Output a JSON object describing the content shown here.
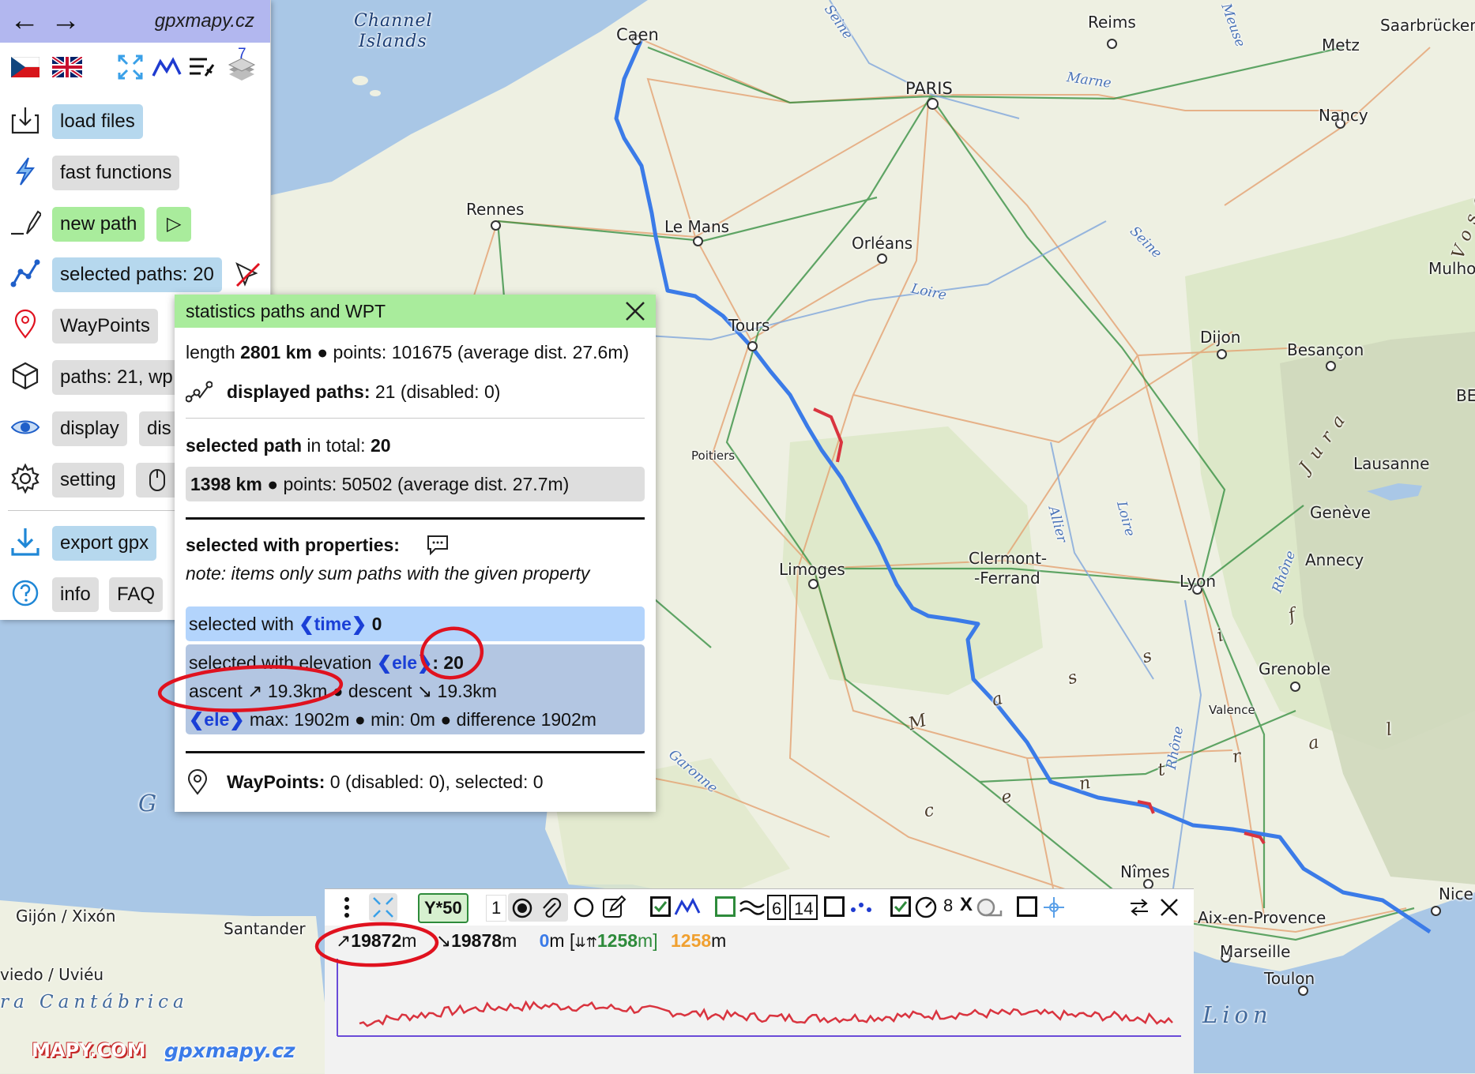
{
  "sidebar": {
    "title": "gpxmapy.cz",
    "back_glyph": "←",
    "forward_glyph": "→",
    "layers_badge": "7",
    "items": [
      {
        "label": "load files",
        "icon": "load-files-icon"
      },
      {
        "label": "fast functions",
        "icon": "lightning-icon"
      },
      {
        "label": "new path",
        "icon": "pencil-line-icon",
        "extra": "▷"
      },
      {
        "label": "selected paths: 20",
        "icon": "path-nodes-icon"
      },
      {
        "label": "WayPoints",
        "icon": "pin-icon"
      },
      {
        "label": "paths: 21, wp",
        "icon": "cube-icon"
      },
      {
        "label": "display",
        "icon": "eye-icon",
        "extra": "dis"
      },
      {
        "label": "setting",
        "icon": "gear-icon"
      },
      {
        "label": "export gpx",
        "icon": "download-icon"
      },
      {
        "label": "info",
        "icon": "help-icon",
        "extra": "FAQ"
      }
    ]
  },
  "stats": {
    "title": "statistics paths and WPT",
    "length_prefix": "length ",
    "length_value": "2801 km",
    "length_rest": " ● points: 101675 (average dist. 27.6m)",
    "displayed_label": "displayed paths:",
    "displayed_value": " 21 (disabled: 0)",
    "selected_label": "selected path",
    "selected_mid": " in total: ",
    "selected_value": "20",
    "selected_km": "1398 km",
    "selected_rest": " ● points: 50502 (average dist. 27.7m)",
    "props_label": "selected with properties:",
    "props_note": "note: items only sum paths with the given property",
    "time_prefix": "selected with ",
    "time_kw": "❮time❯",
    "time_value": " 0",
    "ele_prefix": "selected with elevation ",
    "ele_kw": "❮ele❯",
    "ele_value": ": 20",
    "ascent_text": "ascent ↗ 19.3km",
    "descent_text": " ● descent ↘ 19.3km",
    "ele_kw2": "❮ele❯",
    "ele_stats": " max: 1902m ● min: 0m ● difference 1902m",
    "wpt_label": "WayPoints:",
    "wpt_value": " 0 (disabled: 0), selected: 0"
  },
  "elev": {
    "scale_label": "Y*50",
    "count_1": "1",
    "box_6": "6",
    "box_14": "14",
    "speed_value": "8",
    "x_label": "X",
    "ascent_arrow": "↗",
    "ascent_value": "19872",
    "ascent_unit": "m",
    "descent_arrow": "↘",
    "descent_value": "19878",
    "descent_unit": "m",
    "min_value": "0",
    "min_unit": "m [",
    "range_icon": "⇊⇈",
    "max_value": "1258",
    "max_unit": "m]",
    "diff_value": "1258",
    "diff_unit": "m"
  },
  "map": {
    "watermark_mapy": "MAPY.COM",
    "watermark_site": "gpxmapy.cz",
    "labels": [
      {
        "text": "Channel"
      },
      {
        "text": "Islands"
      },
      {
        "text": "Caen"
      },
      {
        "text": "Reims"
      },
      {
        "text": "Metz"
      },
      {
        "text": "Saarbrücken"
      },
      {
        "text": "PARIS"
      },
      {
        "text": "Nancy"
      },
      {
        "text": "Rennes"
      },
      {
        "text": "Le Mans"
      },
      {
        "text": "Orléans"
      },
      {
        "text": "Mulho"
      },
      {
        "text": "Tours"
      },
      {
        "text": "Dijon"
      },
      {
        "text": "Besançon"
      },
      {
        "text": "BE"
      },
      {
        "text": "Poitiers"
      },
      {
        "text": "Lausanne"
      },
      {
        "text": "Genève"
      },
      {
        "text": "Annecy"
      },
      {
        "text": "Limoges"
      },
      {
        "text": "Clermont-"
      },
      {
        "text": "-Ferrand"
      },
      {
        "text": "Lyon"
      },
      {
        "text": "Grenoble"
      },
      {
        "text": "Valence"
      },
      {
        "text": "Nîmes"
      },
      {
        "text": "Aix-en-Provence"
      },
      {
        "text": "Marseille"
      },
      {
        "text": "Toulon"
      },
      {
        "text": "Nice"
      },
      {
        "text": "Gijón / Xixón"
      },
      {
        "text": "Santander"
      },
      {
        "text": "viedo / Uviéu"
      },
      {
        "text": "Seine"
      },
      {
        "text": "Meuse"
      },
      {
        "text": "Marne"
      },
      {
        "text": "Loire"
      },
      {
        "text": "Seine"
      },
      {
        "text": "Allier"
      },
      {
        "text": "Loire"
      },
      {
        "text": "Rhône"
      },
      {
        "text": "Rhône"
      },
      {
        "text": "Garonne"
      },
      {
        "text": "Vosges"
      },
      {
        "text": "Jura"
      },
      {
        "text": "G"
      },
      {
        "text": "Lion"
      },
      {
        "text": "ra  Cantábrica"
      },
      {
        "text": "M a s s i f"
      },
      {
        "text": "c e n t r a l"
      }
    ]
  },
  "colors": {
    "path_blue": "#3b7be8",
    "path_red": "#d9343f",
    "header_green": "#a9ec9c",
    "header_purple": "#b2b7ef",
    "time_blue": "#b3d4fc",
    "ele_blue": "#b3c6e2",
    "annotation_red": "#e0121f"
  }
}
